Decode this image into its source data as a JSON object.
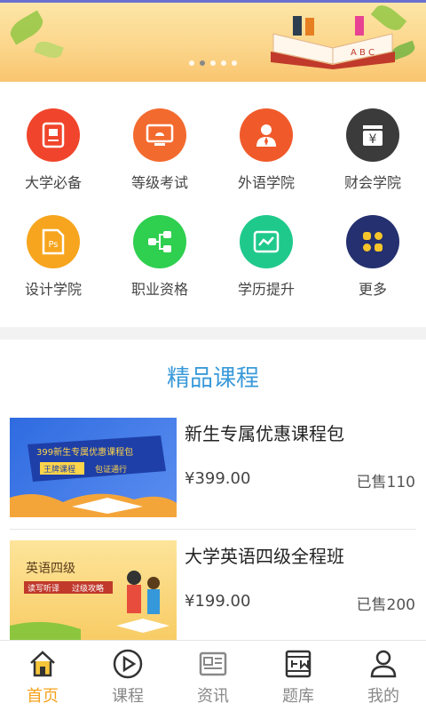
{
  "banner": {
    "dot_count": 5,
    "active_dot": 1,
    "book_letters": "A B C"
  },
  "categories": [
    {
      "label": "大学必备",
      "color": "#f0452c",
      "icon": "id-card-icon"
    },
    {
      "label": "等级考试",
      "color": "#f36a2e",
      "icon": "monitor-icon"
    },
    {
      "label": "外语学院",
      "color": "#f05a2a",
      "icon": "person-icon"
    },
    {
      "label": "财会学院",
      "color": "#3b3b3b",
      "icon": "yen-icon"
    },
    {
      "label": "设计学院",
      "color": "#f7a51e",
      "icon": "ps-icon"
    },
    {
      "label": "职业资格",
      "color": "#2fcf4f",
      "icon": "org-chart-icon"
    },
    {
      "label": "学历提升",
      "color": "#1fc98c",
      "icon": "trend-icon"
    },
    {
      "label": "更多",
      "color": "#24306f",
      "icon": "grid-more-icon"
    }
  ],
  "section": {
    "title": "精品课程"
  },
  "courses": [
    {
      "title": "新生专属优惠课程包",
      "price": "¥399.00",
      "sold": "已售110",
      "thumb_text": "399新生专属优惠课程包",
      "thumb_tags": [
        "王牌课程",
        "包证通行"
      ]
    },
    {
      "title": "大学英语四级全程班",
      "price": "¥199.00",
      "sold": "已售200",
      "thumb_text": "英语四级",
      "thumb_tags": [
        "读写听译",
        "过级攻略"
      ]
    }
  ],
  "tabs": [
    {
      "label": "首页",
      "icon": "home-icon",
      "active": true
    },
    {
      "label": "课程",
      "icon": "play-icon",
      "active": false
    },
    {
      "label": "资讯",
      "icon": "news-icon",
      "active": false
    },
    {
      "label": "题库",
      "icon": "question-bank-icon",
      "active": false
    },
    {
      "label": "我的",
      "icon": "profile-icon",
      "active": false
    }
  ],
  "colors": {
    "accent": "#f6a21c",
    "title_blue": "#3a9ad9"
  }
}
